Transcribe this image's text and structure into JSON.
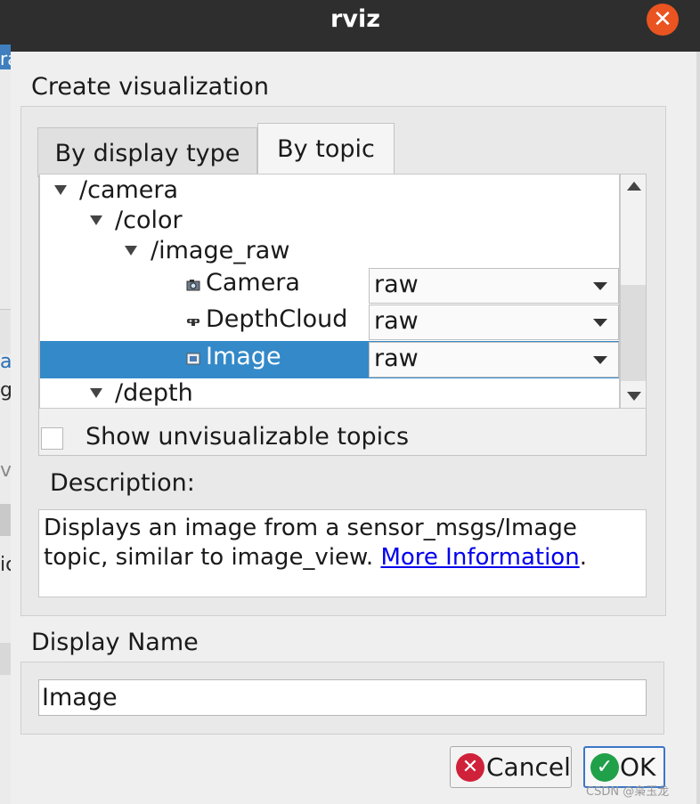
{
  "window": {
    "title": "rviz"
  },
  "background_app": {
    "fragments": [
      "ra",
      "a",
      "g",
      "v",
      "ic"
    ]
  },
  "dialog": {
    "heading": "Create visualization",
    "tabs": [
      {
        "label": "By display type",
        "active": false
      },
      {
        "label": "By topic",
        "active": true
      }
    ],
    "tree": [
      {
        "label": "/camera",
        "level": 0,
        "expanded": true
      },
      {
        "label": "/color",
        "level": 1,
        "expanded": true
      },
      {
        "label": "/image_raw",
        "level": 2,
        "expanded": true
      },
      {
        "label": "Camera",
        "level": 3,
        "icon": "camera-icon",
        "value": "raw",
        "selected": false
      },
      {
        "label": "DepthCloud",
        "level": 3,
        "icon": "depth-cloud-icon",
        "value": "raw",
        "selected": false
      },
      {
        "label": "Image",
        "level": 3,
        "icon": "image-icon",
        "value": "raw",
        "selected": true
      },
      {
        "label": "/depth",
        "level": 1,
        "expanded": true
      }
    ],
    "show_unvisualizable": {
      "label": "Show unvisualizable topics",
      "checked": false
    },
    "description": {
      "label": "Description:",
      "text": "Displays an image from a sensor_msgs/Image topic, similar to image_view.",
      "link": "More Information",
      "trailing": "."
    },
    "display_name": {
      "label": "Display Name",
      "value": "Image"
    },
    "buttons": {
      "cancel": "Cancel",
      "ok": "OK"
    }
  },
  "watermark": "CSDN @枭玉龙",
  "colors": {
    "titlebar": "#2e2e2e",
    "close": "#e95420",
    "selection": "#3489c8",
    "link": "#0000ee",
    "cancel_icon": "#d0213a",
    "ok_icon": "#21a04a"
  }
}
